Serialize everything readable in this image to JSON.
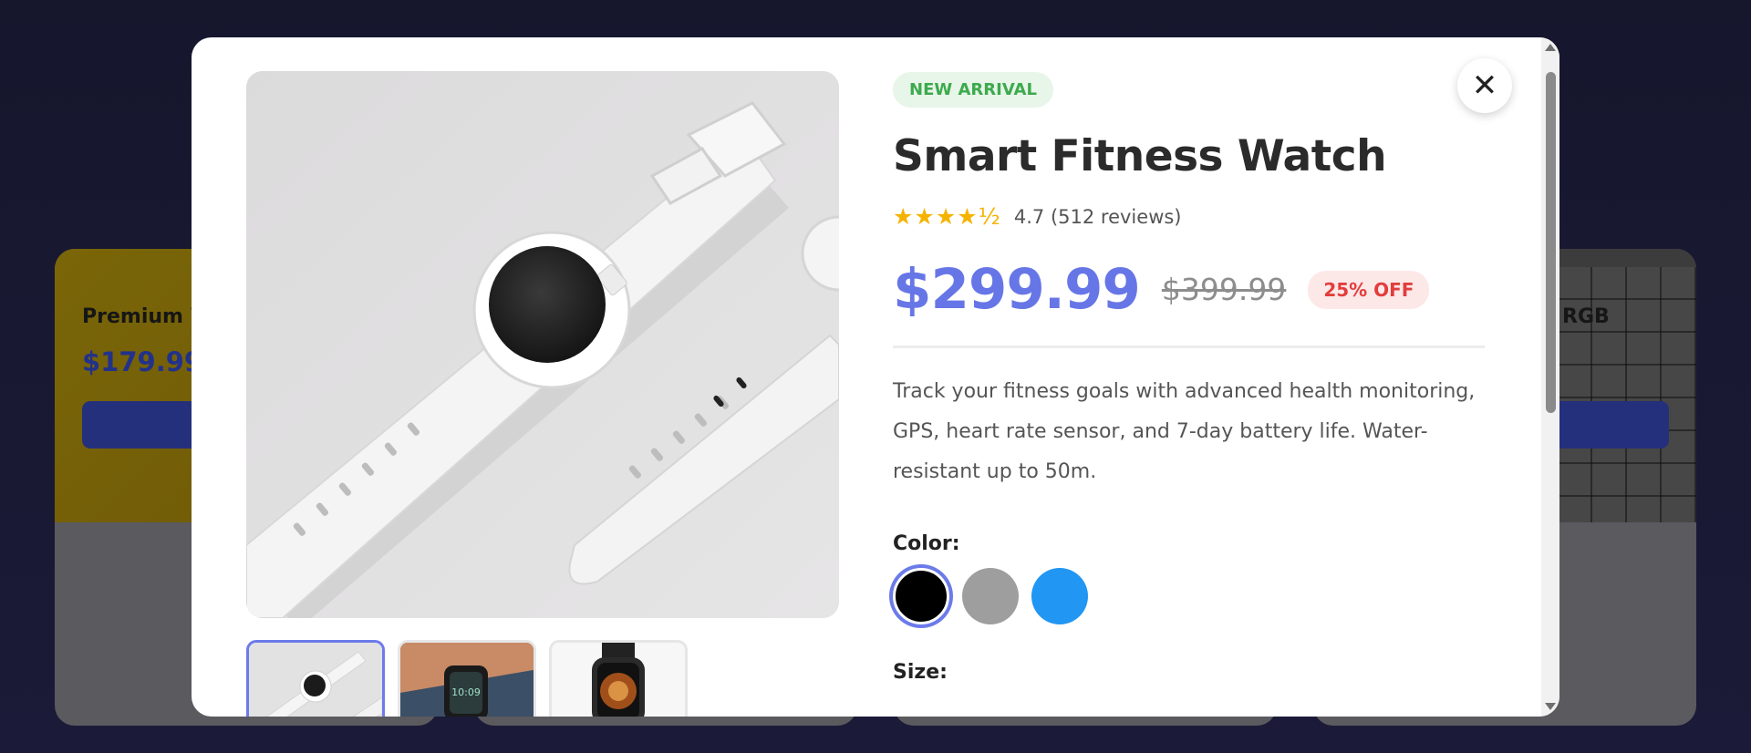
{
  "background": {
    "cards": [
      {
        "title": "Premium W",
        "price": "$179.99"
      },
      {
        "title": "",
        "price": ""
      },
      {
        "title": "",
        "price": ""
      },
      {
        "title": "RGB",
        "price": ""
      }
    ]
  },
  "modal": {
    "close_icon": "close-icon",
    "badge": "NEW ARRIVAL",
    "title": "Smart Fitness Watch",
    "stars": "★★★★½",
    "rating_text": "4.7 (512 reviews)",
    "rating_value": 4.7,
    "price": "$299.99",
    "old_price": "$399.99",
    "discount": "25% OFF",
    "description": "Track your fitness goals with advanced health monitoring, GPS, heart rate sensor, and 7-day battery life. Water-resistant up to 50m.",
    "color_label": "Color:",
    "colors": [
      {
        "name": "black",
        "hex": "#000000",
        "selected": true
      },
      {
        "name": "gray",
        "hex": "#9e9e9e",
        "selected": false
      },
      {
        "name": "blue",
        "hex": "#2196f3",
        "selected": false
      }
    ],
    "size_label": "Size:",
    "thumbnails": [
      "white-smartwatch-thumbnail",
      "wrist-watch-thumbnail",
      "black-watch-thumbnail"
    ]
  },
  "colors": {
    "accent": "#6c7bea",
    "badge_green": "#3daa4d",
    "discount_red": "#e23d3d",
    "star_gold": "#f5b301"
  }
}
